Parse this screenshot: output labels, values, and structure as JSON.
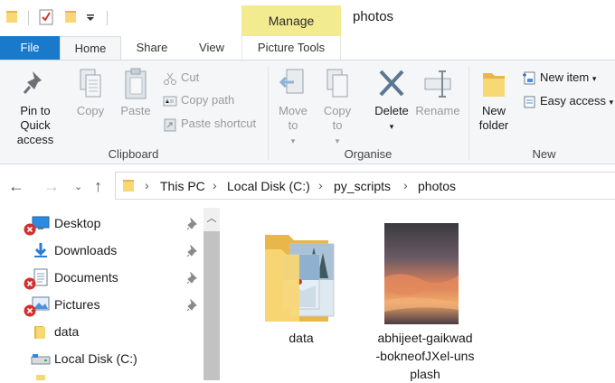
{
  "titlebar": {
    "contextual_tab": "Manage",
    "window_title": "photos"
  },
  "tabs": {
    "file": "File",
    "home": "Home",
    "share": "Share",
    "view": "View",
    "picture_tools": "Picture Tools"
  },
  "ribbon": {
    "clipboard": {
      "pin_to_quick_access": "Pin to Quick access",
      "copy": "Copy",
      "paste": "Paste",
      "cut": "Cut",
      "copy_path": "Copy path",
      "paste_shortcut": "Paste shortcut",
      "group_label": "Clipboard"
    },
    "organise": {
      "move_to": "Move to",
      "copy_to": "Copy to",
      "delete": "Delete",
      "rename": "Rename",
      "group_label": "Organise"
    },
    "new": {
      "new_folder": "New folder",
      "new_item": "New item",
      "easy_access": "Easy access",
      "group_label": "New"
    }
  },
  "address": {
    "crumbs": [
      "This PC",
      "Local Disk (C:)",
      "py_scripts",
      "photos"
    ]
  },
  "navpane": {
    "items": [
      {
        "label": "Desktop",
        "icon": "desktop-icon",
        "pinned": true,
        "error": true
      },
      {
        "label": "Downloads",
        "icon": "downloads-icon",
        "pinned": true,
        "error": false
      },
      {
        "label": "Documents",
        "icon": "documents-icon",
        "pinned": true,
        "error": true
      },
      {
        "label": "Pictures",
        "icon": "pictures-icon",
        "pinned": true,
        "error": true
      },
      {
        "label": "data",
        "icon": "folder-icon",
        "pinned": false,
        "error": false
      },
      {
        "label": "Local Disk (C:)",
        "icon": "drive-icon",
        "pinned": false,
        "error": false
      }
    ]
  },
  "content": {
    "items": [
      {
        "name": "data",
        "type": "folder"
      },
      {
        "name_lines": [
          "abhijeet-gaikwad",
          "-bokneofJXel-uns",
          "plash"
        ],
        "type": "image"
      }
    ]
  },
  "colors": {
    "file_tab": "#1979ca",
    "manage_tab": "#f3eb8f",
    "ribbon_bg": "#f5f6f7",
    "folder_yellow": "#f8d775"
  }
}
